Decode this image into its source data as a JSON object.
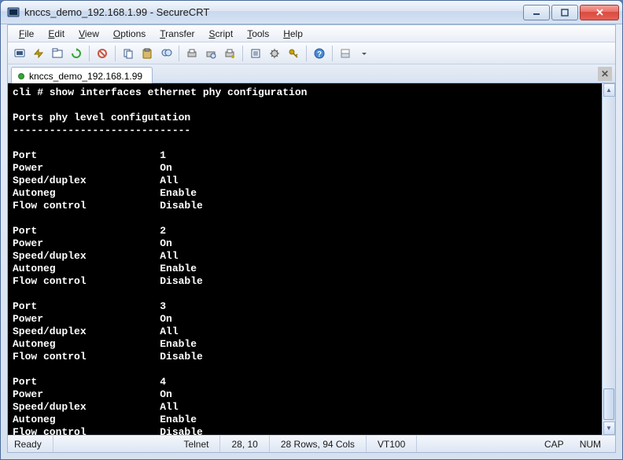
{
  "window": {
    "title": "knccs_demo_192.168.1.99 - SecureCRT"
  },
  "menu": {
    "items": [
      {
        "label": "File",
        "u": "F"
      },
      {
        "label": "Edit",
        "u": "E"
      },
      {
        "label": "View",
        "u": "V"
      },
      {
        "label": "Options",
        "u": "O"
      },
      {
        "label": "Transfer",
        "u": "T"
      },
      {
        "label": "Script",
        "u": "S"
      },
      {
        "label": "Tools",
        "u": "T"
      },
      {
        "label": "Help",
        "u": "H"
      }
    ]
  },
  "toolbar": {
    "icons": [
      "connect",
      "quick-connect",
      "connect-tab",
      "reconnect",
      "sep",
      "disconnect",
      "sep",
      "copy",
      "paste",
      "find",
      "sep",
      "print",
      "print-preview",
      "print-setup",
      "sep",
      "properties",
      "options",
      "key",
      "sep",
      "help",
      "sep",
      "toggle",
      "dropdown"
    ]
  },
  "tab": {
    "label": "knccs_demo_192.168.1.99"
  },
  "terminal": {
    "prompt": "cli # ",
    "command": "show interfaces ethernet phy configuration",
    "header": "Ports phy level configutation",
    "rule": "-----------------------------",
    "fields": [
      "Port",
      "Power",
      "Speed/duplex",
      "Autoneg",
      "Flow control"
    ],
    "ports": [
      {
        "Port": "1",
        "Power": "On",
        "Speed/duplex": "All",
        "Autoneg": "Enable",
        "Flow control": "Disable"
      },
      {
        "Port": "2",
        "Power": "On",
        "Speed/duplex": "All",
        "Autoneg": "Enable",
        "Flow control": "Disable"
      },
      {
        "Port": "3",
        "Power": "On",
        "Speed/duplex": "All",
        "Autoneg": "Enable",
        "Flow control": "Disable"
      },
      {
        "Port": "4",
        "Power": "On",
        "Speed/duplex": "All",
        "Autoneg": "Enable",
        "Flow control": "Disable"
      }
    ],
    "label_col_width": 24
  },
  "status": {
    "ready": "Ready",
    "protocol": "Telnet",
    "cursor": "28, 10",
    "size": "28 Rows, 94 Cols",
    "emulation": "VT100",
    "cap": "CAP",
    "num": "NUM"
  }
}
